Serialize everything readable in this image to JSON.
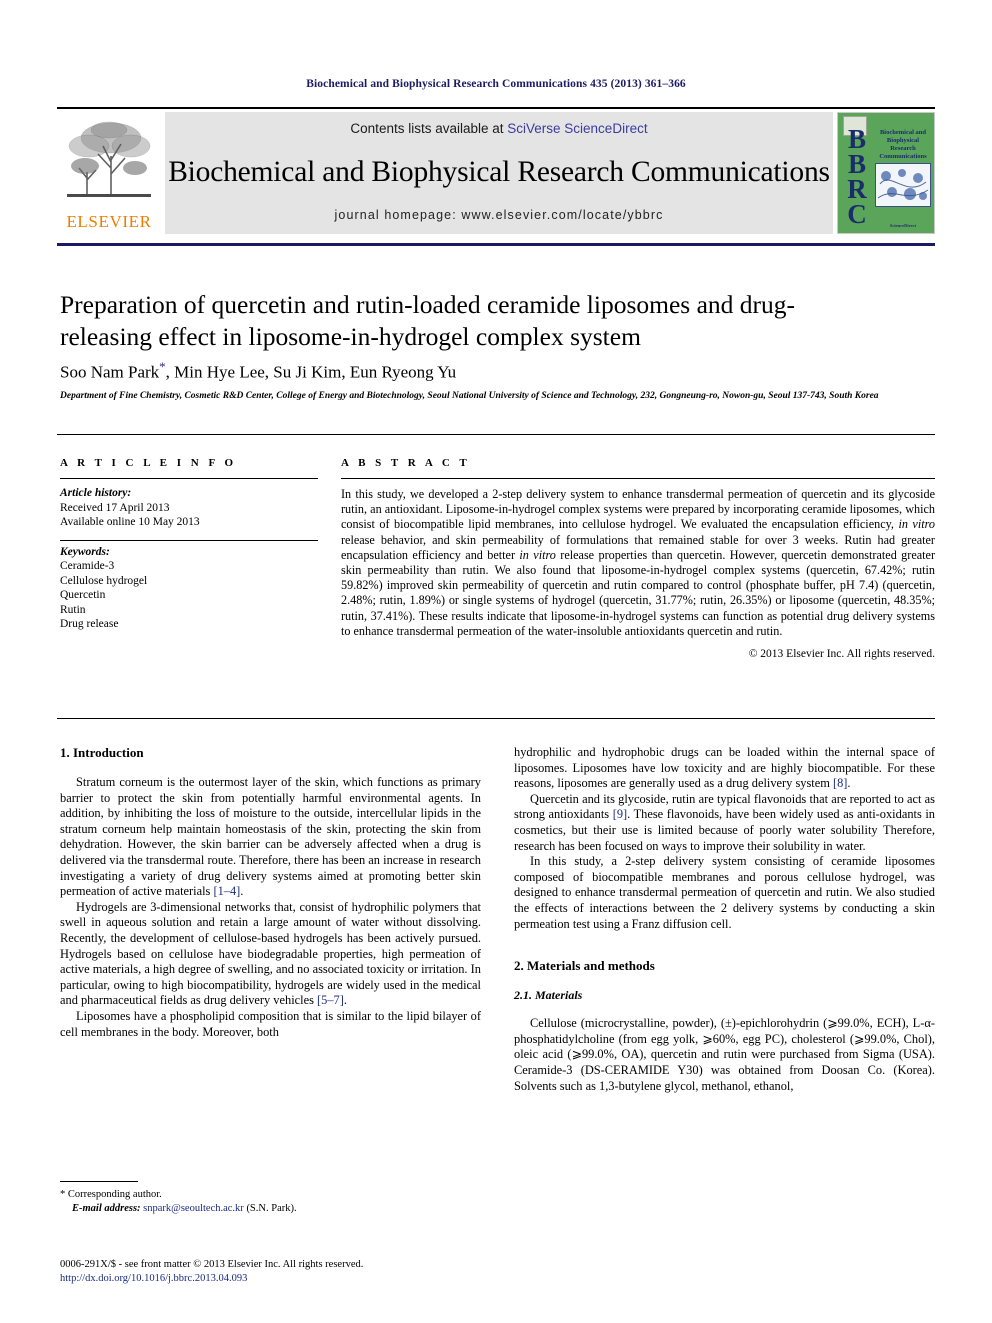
{
  "running_head": "Biochemical and Biophysical Research Communications 435 (2013) 361–366",
  "masthead": {
    "contents_prefix": "Contents lists available at ",
    "contents_link": "SciVerse ScienceDirect",
    "journal_name": "Biochemical and Biophysical Research Communications",
    "homepage": "journal homepage: www.elsevier.com/locate/ybbrc",
    "elsevier_wordmark": "ELSEVIER",
    "bbrc_letters": "BBRC",
    "bbrc_title": "Biochemical and Biophysical Research Communications",
    "bbrc_foot": "ScienceDirect",
    "colors": {
      "running_head": "#1b1b64",
      "rule": "#1b1b64",
      "sciencedirect_link": "#3b3b9e",
      "elsevier_orange": "#f07d00",
      "bbrc_green": "#5aa55a",
      "bbrc_navy": "#1b2c6b",
      "masthead_bg": "#e4e4e4"
    }
  },
  "article": {
    "title": "Preparation of quercetin and rutin-loaded ceramide liposomes and drug-releasing effect in liposome-in-hydrogel complex system",
    "authors": "Soo Nam Park",
    "corresponding_mark": "*",
    "authors_rest": ", Min Hye Lee, Su Ji Kim, Eun Ryeong Yu",
    "affiliation": "Department of Fine Chemistry, Cosmetic R&D Center, College of Energy and Biotechnology, Seoul National University of Science and Technology, 232, Gongneung-ro, Nowon-gu, Seoul 137-743, South Korea"
  },
  "article_info": {
    "heading": "A R T I C L E   I N F O",
    "history_label": "Article history:",
    "history": [
      "Received 17 April 2013",
      "Available online 10 May 2013"
    ],
    "keywords_label": "Keywords:",
    "keywords": [
      "Ceramide-3",
      "Cellulose hydrogel",
      "Quercetin",
      "Rutin",
      "Drug release"
    ]
  },
  "abstract": {
    "heading": "A B S T R A C T",
    "text_1": "In this study, we developed a 2-step delivery system to enhance transdermal permeation of quercetin and its glycoside rutin, an antioxidant. Liposome-in-hydrogel complex systems were prepared by incorporating ceramide liposomes, which consist of biocompatible lipid membranes, into cellulose hydrogel. We evaluated the encapsulation efficiency, ",
    "italic_1": "in vitro",
    "text_2": " release behavior, and skin permeability of formulations that remained stable for over 3 weeks. Rutin had greater encapsulation efficiency and better ",
    "italic_2": "in vitro",
    "text_3": " release properties than quercetin. However, quercetin demonstrated greater skin permeability than rutin. We also found that liposome-in-hydrogel complex systems (quercetin, 67.42%; rutin 59.82%) improved skin permeability of quercetin and rutin compared to control (phosphate buffer, pH 7.4) (quercetin, 2.48%; rutin, 1.89%) or single systems of hydrogel (quercetin, 31.77%; rutin, 26.35%) or liposome (quercetin, 48.35%; rutin, 37.41%). These results indicate that liposome-in-hydrogel systems can function as potential drug delivery systems to enhance transdermal permeation of the water-insoluble antioxidants quercetin and rutin.",
    "rights": "© 2013 Elsevier Inc. All rights reserved."
  },
  "body": {
    "left": {
      "section_1_heading": "1. Introduction",
      "para_1_a": "Stratum corneum is the outermost layer of the skin, which functions as primary barrier to protect the skin from potentially harmful environmental agents. In addition, by inhibiting the loss of moisture to the outside, intercellular lipids in the stratum corneum help maintain homeostasis of the skin, protecting the skin from dehydration. However, the skin barrier can be adversely affected when a drug is delivered via the transdermal route. Therefore, there has been an increase in research investigating a variety of drug delivery systems aimed at promoting better skin permeation of active materials ",
      "para_1_ref": "[1–4]",
      "para_1_b": ".",
      "para_2_a": "Hydrogels are 3-dimensional networks that, consist of hydrophilic polymers that swell in aqueous solution and retain a large amount of water without dissolving. Recently, the development of cellulose-based hydrogels has been actively pursued. Hydrogels based on cellulose have biodegradable properties, high permeation of active materials, a high degree of swelling, and no associated toxicity or irritation. In particular, owing to high biocompatibility, hydrogels are widely used in the medical and pharmaceutical fields as drug delivery vehicles ",
      "para_2_ref": "[5–7]",
      "para_2_b": ".",
      "para_3": "Liposomes have a phospholipid composition that is similar to the lipid bilayer of cell membranes in the body. Moreover, both"
    },
    "right": {
      "para_4_a": "hydrophilic and hydrophobic drugs can be loaded within the internal space of liposomes. Liposomes have low toxicity and are highly biocompatible. For these reasons, liposomes are generally used as a drug delivery system ",
      "para_4_ref": "[8]",
      "para_4_b": ".",
      "para_5_a": "Quercetin and its glycoside, rutin are typical flavonoids that are reported to act as strong antioxidants ",
      "para_5_ref": "[9]",
      "para_5_b": ". These flavonoids, have been widely used as anti-oxidants in cosmetics, but their use is limited because of poorly water solubility Therefore, research has been focused on ways to improve their solubility in water.",
      "para_6": "In this study, a 2-step delivery system consisting of ceramide liposomes composed of biocompatible membranes and porous cellulose hydrogel, was designed to enhance transdermal permeation of quercetin and rutin. We also studied the effects of interactions between the 2 delivery systems by conducting a skin permeation test using a Franz diffusion cell.",
      "section_2_heading": "2. Materials and methods",
      "section_21_heading": "2.1. Materials",
      "para_7": "Cellulose (microcrystalline, powder), (±)-epichlorohydrin (⩾99.0%, ECH), L-α-phosphatidylcholine (from egg yolk, ⩾60%, egg PC), cholesterol (⩾99.0%, Chol), oleic acid (⩾99.0%, OA), quercetin and rutin were purchased from Sigma (USA). Ceramide-3 (DS-CERAMIDE Y30) was obtained from Doosan Co. (Korea). Solvents such as 1,3-butylene glycol, methanol, ethanol,"
    }
  },
  "footnote": {
    "star": "*",
    "corresponding": "Corresponding author.",
    "email_label": "E-mail address:",
    "email": "snpark@seoultech.ac.kr",
    "email_suffix": " (S.N. Park)."
  },
  "footer": {
    "issn_line": "0006-291X/$ - see front matter © 2013 Elsevier Inc. All rights reserved.",
    "doi": "http://dx.doi.org/10.1016/j.bbrc.2013.04.093"
  }
}
